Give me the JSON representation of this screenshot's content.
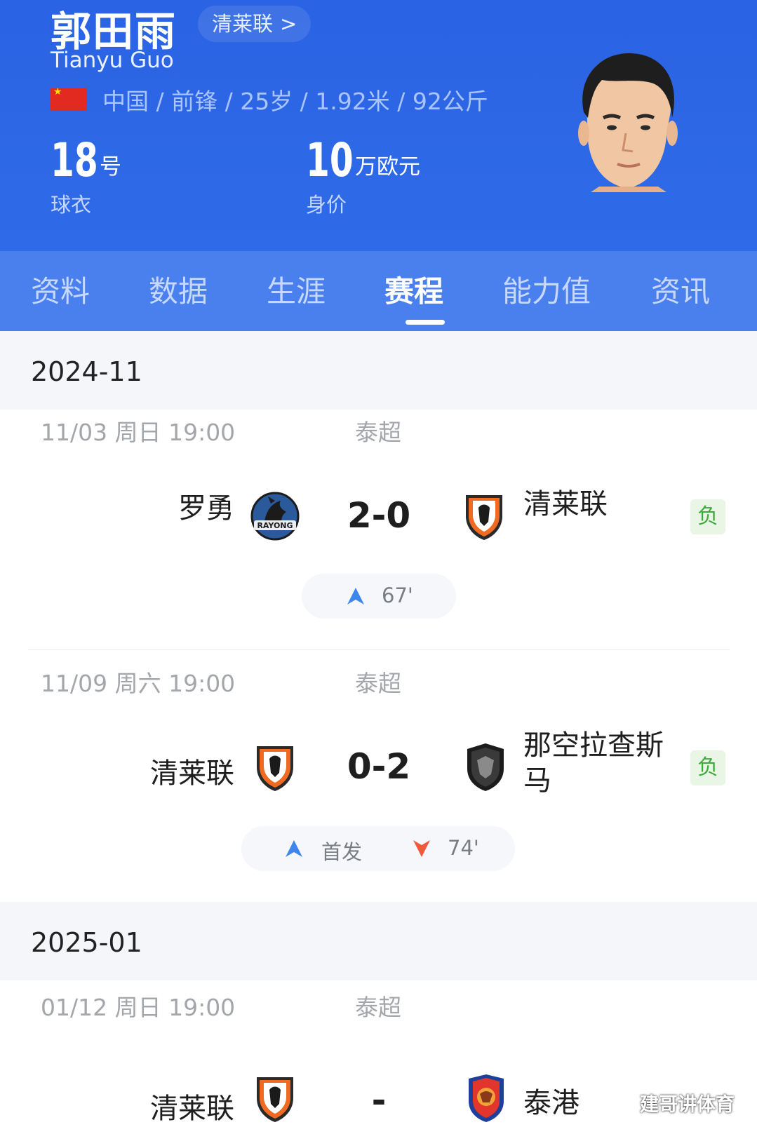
{
  "player": {
    "name_cn": "郭田雨",
    "name_en": "Tianyu Guo",
    "club_link": "清莱联",
    "club_link_arrow": ">",
    "info": "中国 / 前锋 / 25岁 / 1.92米 / 92公斤",
    "flag": "china-flag",
    "jersey_number": "18",
    "jersey_unit": "号",
    "jersey_caption": "球衣",
    "market_value": "10",
    "market_value_unit": "万欧元",
    "market_value_caption": "身价"
  },
  "tabs": [
    {
      "label": "资料",
      "active": false
    },
    {
      "label": "数据",
      "active": false
    },
    {
      "label": "生涯",
      "active": false
    },
    {
      "label": "赛程",
      "active": true
    },
    {
      "label": "能力值",
      "active": false
    },
    {
      "label": "资讯",
      "active": false
    }
  ],
  "months": [
    {
      "label": "2024-11",
      "matches": [
        {
          "date": "11/03  周日 19:00",
          "league": "泰超",
          "home": "罗勇",
          "away": "清莱联",
          "score": "2-0",
          "result": "负",
          "events": [
            {
              "type": "sub-in",
              "label": "67'"
            }
          ]
        },
        {
          "date": "11/09  周六 19:00",
          "league": "泰超",
          "home": "清莱联",
          "away": "那空拉查斯马",
          "score": "0-2",
          "result": "负",
          "events": [
            {
              "type": "start",
              "label": "首发"
            },
            {
              "type": "sub-out",
              "label": "74'"
            }
          ]
        }
      ]
    },
    {
      "label": "2025-01",
      "matches": [
        {
          "date": "01/12  周日 19:00",
          "league": "泰超",
          "home": "清莱联",
          "away": "泰港",
          "score": "-"
        }
      ]
    }
  ],
  "colors": {
    "header_blue": "#2f6be8",
    "tab_bar_blue": "#4a7fee",
    "loss_green": "#3cab3c",
    "sub_in_blue": "#3f86ec",
    "sub_out_red": "#ef5a3a"
  },
  "watermark": "建哥讲体育"
}
